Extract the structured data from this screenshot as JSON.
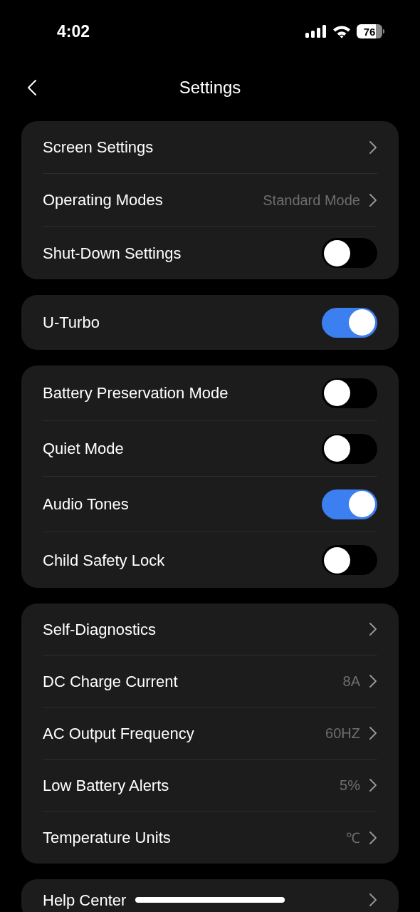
{
  "status_bar": {
    "time": "4:02",
    "battery": "76"
  },
  "nav": {
    "title": "Settings"
  },
  "groups": [
    {
      "rows": [
        {
          "kind": "link",
          "label": "Screen Settings"
        },
        {
          "kind": "link",
          "label": "Operating Modes",
          "value": "Standard Mode"
        },
        {
          "kind": "toggle",
          "label": "Shut-Down Settings",
          "on": false
        }
      ]
    },
    {
      "rows": [
        {
          "kind": "toggle",
          "label": "U-Turbo",
          "on": true
        }
      ]
    },
    {
      "rows": [
        {
          "kind": "toggle",
          "label": "Battery Preservation Mode",
          "on": false
        },
        {
          "kind": "toggle",
          "label": "Quiet Mode",
          "on": false
        },
        {
          "kind": "toggle",
          "label": "Audio Tones",
          "on": true
        },
        {
          "kind": "toggle",
          "label": "Child Safety Lock",
          "on": false
        }
      ]
    },
    {
      "rows": [
        {
          "kind": "link",
          "label": "Self-Diagnostics"
        },
        {
          "kind": "link",
          "label": "DC Charge Current",
          "value": "8A"
        },
        {
          "kind": "link",
          "label": "AC Output Frequency",
          "value": "60HZ"
        },
        {
          "kind": "link",
          "label": "Low Battery Alerts",
          "value": "5%"
        },
        {
          "kind": "link",
          "label": "Temperature Units",
          "value": "℃"
        }
      ]
    },
    {
      "rows": [
        {
          "kind": "link",
          "label": "Help Center"
        }
      ]
    }
  ]
}
